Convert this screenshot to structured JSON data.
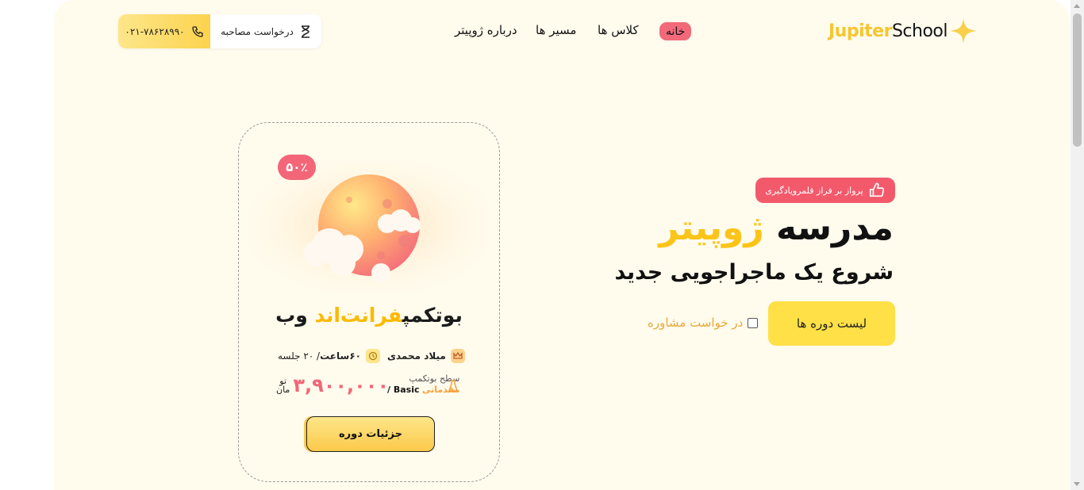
{
  "header": {
    "logo": {
      "word1": "Jupiter",
      "word2": "School"
    },
    "nav": [
      {
        "label": "خانه"
      },
      {
        "label": "کلاس ها"
      },
      {
        "label": "مسیر ها"
      },
      {
        "label": "درباره ژوپیتر"
      }
    ],
    "phone": "۰۲۱-۷۸۶۲۸۹۹۰",
    "interview_label": "درخواست مصاحبه"
  },
  "hero": {
    "badge": "پرواز بر فراز قلمرویادگیری",
    "title_plain": "مدرسه",
    "title_highlight": "ژوپیتر",
    "subtitle": "شروع یک ماجراجویی جدید",
    "primary_button": "لیست دوره ها",
    "consult_label": "در خواست مشاوره",
    "consult_checked": false
  },
  "course_card": {
    "discount": "۵۰٪",
    "title_plain_1": "بوتکمپ",
    "title_highlight": "فرانت‌اند",
    "title_plain_2": "وب",
    "instructor": "میلاد محمدی",
    "duration_bold": "۶۰ساعت",
    "duration_rest": "/ ۲۰ جلسه",
    "level_label": "سطح بوتکمپ",
    "level_value_intro": "مقدماتی",
    "level_value_basic": "Basic /",
    "price": "۳,۹۰۰,۰۰۰",
    "currency_top": "تو",
    "currency_bottom": "مان",
    "details_button": "جزئیات دوره"
  },
  "colors": {
    "page_bg": "#fffbed",
    "accent_yellow": "#fcc419",
    "accent_pink": "#f26678"
  }
}
